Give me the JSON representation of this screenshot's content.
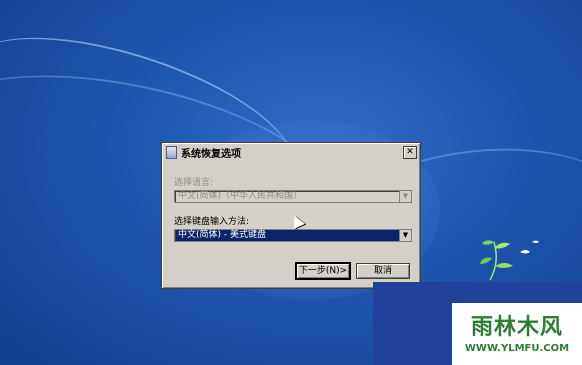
{
  "dialog": {
    "title": "系统恢复选项",
    "close_label": "✕",
    "language_label": "选择语言:",
    "language_value": "中文(简体)（中华人民共和国）",
    "keyboard_label": "选择键盘输入方法:",
    "keyboard_value": "中文(简体) - 美式键盘",
    "next_label": "下一步(N)>",
    "cancel_label": "取消"
  },
  "watermark": {
    "logo": "雨林木风",
    "url": "WWW.YLMFU.COM"
  }
}
